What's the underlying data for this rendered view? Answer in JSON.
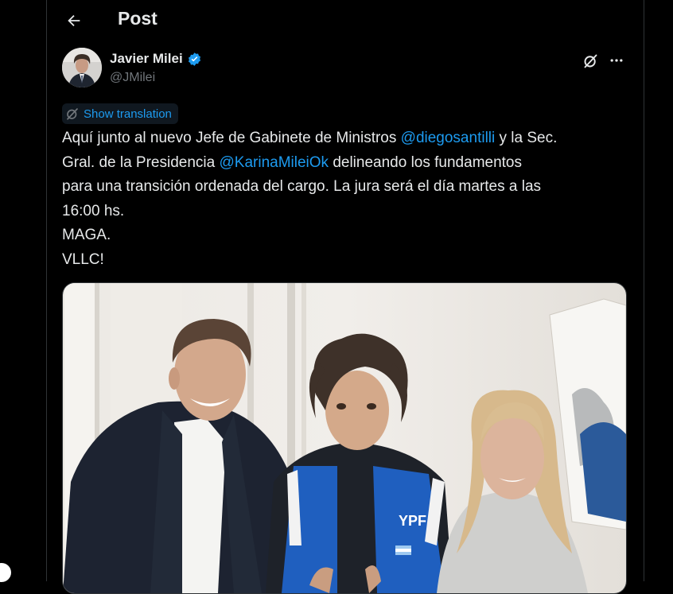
{
  "header": {
    "title": "Post",
    "back_icon": "arrow-left-icon"
  },
  "author": {
    "name": "Javier Milei",
    "handle": "@JMilei",
    "verified_icon": "verified-badge-icon",
    "verified_color": "#1d9bf0"
  },
  "actions": {
    "grok_icon": "grok-icon",
    "more_icon": "more-horizontal-icon"
  },
  "translate": {
    "label": "Show translation",
    "icon": "translate-icon"
  },
  "tweet": {
    "line1_pre": "Aquí junto al nuevo Jefe de Gabinete de Ministros ",
    "mention1": "@diegosantilli",
    "line1_post": " y la Sec.",
    "line2_pre": "Gral. de la Presidencia ",
    "mention2": "@KarinaMileiOk",
    "line2_post": " delineando los fundamentos",
    "line3": "para una transición ordenada del cargo. La jura será el día martes a las",
    "line4": "16:00 hs.",
    "line5": "MAGA.",
    "line6": "VLLC!"
  },
  "media": {
    "jacket_logo": "YPF"
  },
  "colors": {
    "accent": "#1d9bf0",
    "background": "#000000",
    "text": "#e7e9ea",
    "secondary": "#71767b"
  }
}
